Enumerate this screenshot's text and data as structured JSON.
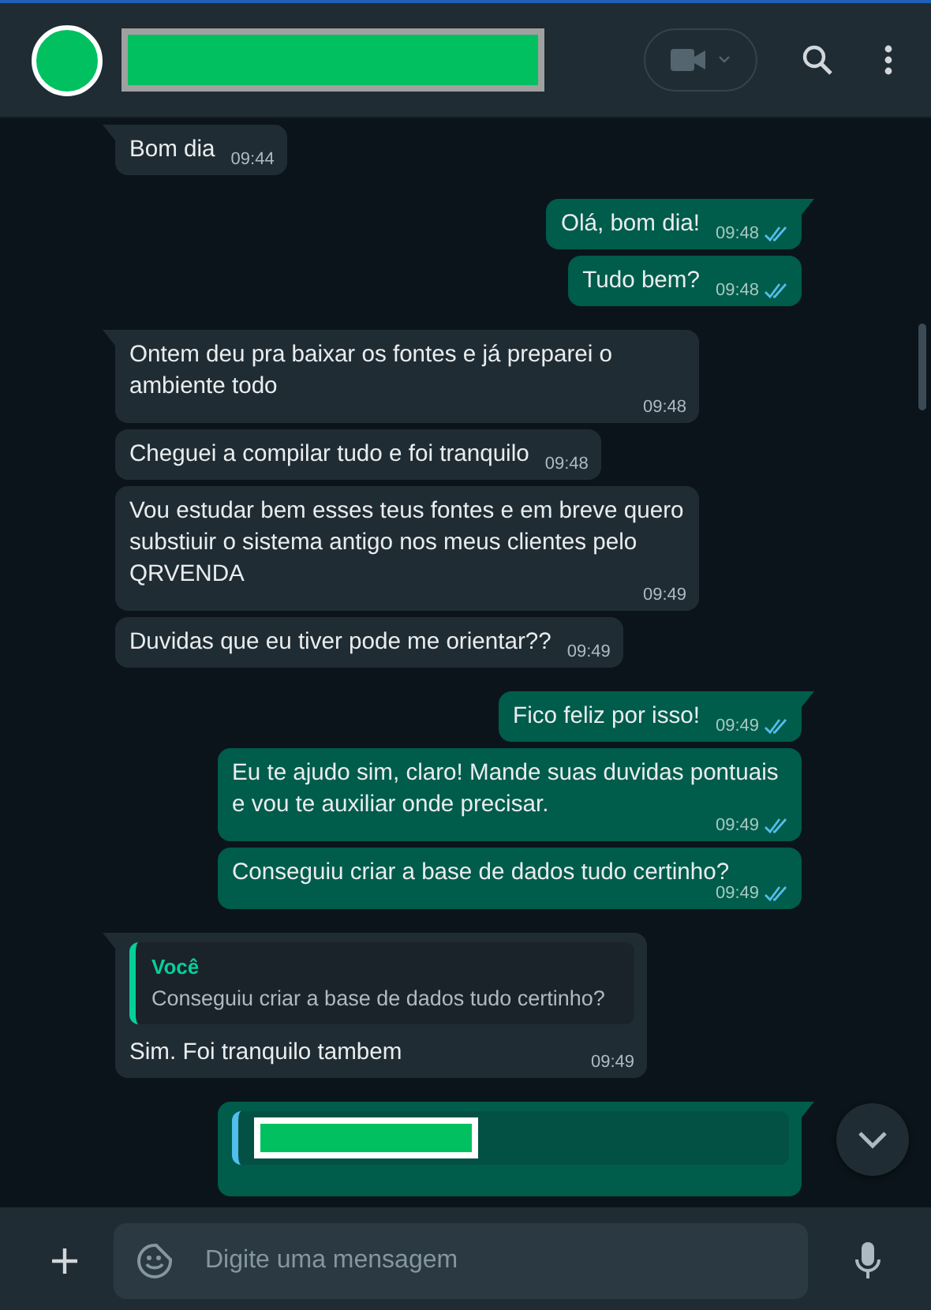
{
  "header": {
    "contact_name_redacted": true
  },
  "messages": [
    {
      "kind": "incoming",
      "text": "Bom dia",
      "time": "09:44"
    },
    {
      "kind": "outgoing",
      "text": "Olá, bom dia!",
      "time": "09:48",
      "read": true
    },
    {
      "kind": "outgoing",
      "text": "Tudo bem?",
      "time": "09:48",
      "read": true
    },
    {
      "kind": "incoming",
      "text": "Ontem deu pra baixar os fontes e já preparei o ambiente todo",
      "time": "09:48"
    },
    {
      "kind": "incoming",
      "text": "Cheguei a compilar tudo e foi tranquilo",
      "time": "09:48"
    },
    {
      "kind": "incoming",
      "text": "Vou estudar bem esses teus fontes e em breve quero substiuir o sistema antigo nos meus clientes pelo QRVENDA",
      "time": "09:49"
    },
    {
      "kind": "incoming",
      "text": "Duvidas que eu tiver pode me orientar??",
      "time": "09:49"
    },
    {
      "kind": "outgoing",
      "text": "Fico feliz por isso!",
      "time": "09:49",
      "read": true
    },
    {
      "kind": "outgoing",
      "text": "Eu te ajudo sim, claro!  Mande suas duvidas pontuais e vou te auxiliar onde precisar.",
      "time": "09:49",
      "read": true
    },
    {
      "kind": "outgoing",
      "text": "Conseguiu criar a base de dados tudo certinho?",
      "time": "09:49",
      "read": true
    },
    {
      "kind": "incoming",
      "text": "Sim. Foi tranquilo tambem",
      "time": "09:49",
      "quote": {
        "kind": "text",
        "author": "Você",
        "text": "Conseguiu criar a base de dados tudo certinho?"
      }
    },
    {
      "kind": "outgoing",
      "quote": {
        "kind": "redacted"
      }
    }
  ],
  "composer": {
    "placeholder": "Digite uma mensagem"
  }
}
